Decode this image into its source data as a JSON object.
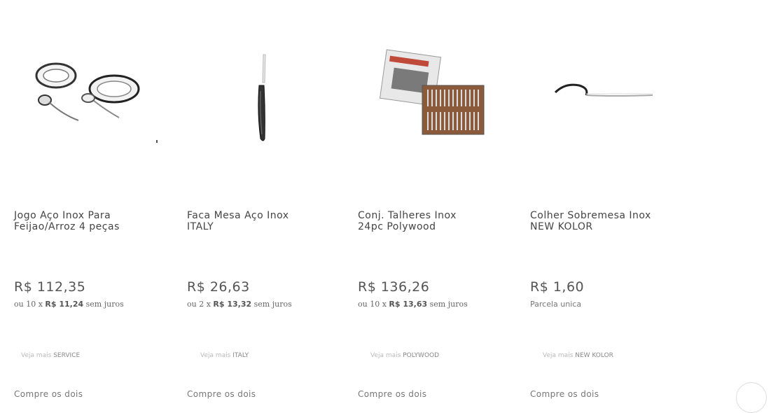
{
  "products": [
    {
      "image_icon": "cookware-set-icon",
      "title_line1": "Jogo Aço Inox Para",
      "title_line2": "Feijao/Arroz 4 peças",
      "price": "R$ 112,35",
      "install_prefix": "ou 10 x",
      "install_value": "R$ 11,24",
      "install_suffix": "sem juros",
      "veja_prefix": "Veja mais",
      "veja_brand": "SERVICE",
      "compre": "Compre os dois"
    },
    {
      "image_icon": "table-knife-icon",
      "title_line1": "Faca Mesa Aço Inox",
      "title_line2": "ITALY",
      "price": "R$ 26,63",
      "install_prefix": "ou 2 x",
      "install_value": "R$ 13,32",
      "install_suffix": "sem juros",
      "veja_prefix": "Veja mais",
      "veja_brand": "ITALY",
      "compre": "Compre os dois"
    },
    {
      "image_icon": "cutlery-set-box-icon",
      "title_line1": "Conj. Talheres Inox",
      "title_line2": "24pc Polywood",
      "price": "R$ 136,26",
      "install_prefix": "ou 10 x",
      "install_value": "R$ 13,63",
      "install_suffix": "sem juros",
      "veja_prefix": "Veja mais",
      "veja_brand": "POLYWOOD",
      "compre": "Compre os dois"
    },
    {
      "image_icon": "dessert-spoon-icon",
      "title_line1": "Colher Sobremesa Inox",
      "title_line2": "NEW KOLOR",
      "price": "R$ 1,60",
      "install_text": "Parcela unica",
      "veja_prefix": "Veja mais",
      "veja_brand": "NEW KOLOR",
      "compre": "Compre os dois"
    }
  ]
}
